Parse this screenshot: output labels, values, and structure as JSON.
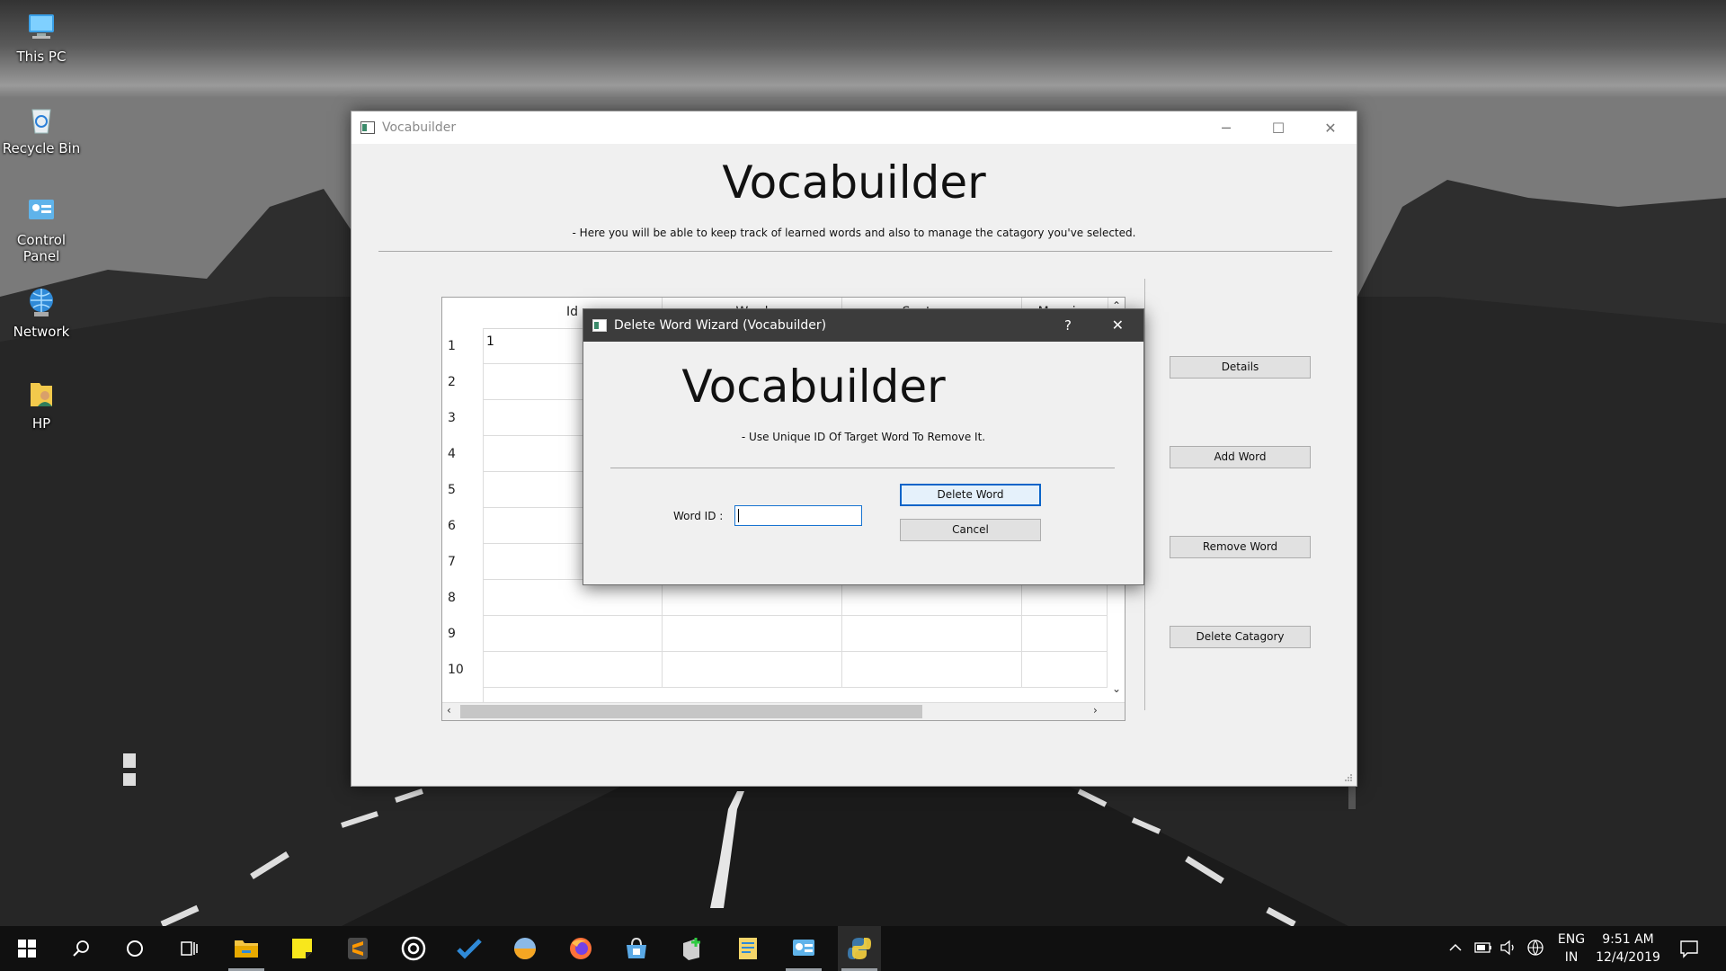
{
  "desktop": {
    "icons": [
      {
        "label": "This PC",
        "icon": "this-pc-icon"
      },
      {
        "label": "Recycle Bin",
        "icon": "recycle-bin-icon"
      },
      {
        "label": "Control Panel",
        "icon": "control-panel-icon"
      },
      {
        "label": "Network",
        "icon": "network-icon"
      },
      {
        "label": "HP",
        "icon": "user-folder-icon"
      }
    ]
  },
  "window": {
    "title": "Vocabuilder",
    "heading": "Vocabuilder",
    "subtitle": "- Here you will be able to keep track of learned words and also to manage the catagory you've selected.",
    "controls": {
      "minimize": "─",
      "maximize": "☐",
      "close": "✕"
    },
    "table": {
      "columns": [
        "Id",
        "Word",
        "Sentence",
        "Meaning"
      ],
      "row_numbers": [
        "1",
        "2",
        "3",
        "4",
        "5",
        "6",
        "7",
        "8",
        "9",
        "10"
      ],
      "rows": [
        [
          "1",
          "",
          "",
          ""
        ],
        [
          "",
          "",
          "",
          ""
        ],
        [
          "",
          "",
          "",
          ""
        ],
        [
          "",
          "",
          "",
          ""
        ],
        [
          "",
          "",
          "",
          ""
        ],
        [
          "",
          "",
          "",
          ""
        ],
        [
          "",
          "",
          "",
          ""
        ],
        [
          "",
          "",
          "",
          ""
        ],
        [
          "",
          "",
          "",
          ""
        ],
        [
          "",
          "",
          "",
          ""
        ]
      ]
    },
    "buttons": {
      "details": "Details",
      "add_word": "Add Word",
      "remove_word": "Remove Word",
      "delete_catagory": "Delete Catagory"
    }
  },
  "dialog": {
    "title": "Delete Word Wizard (Vocabuilder)",
    "help": "?",
    "close": "✕",
    "heading": "Vocabuilder",
    "subtitle": "- Use Unique ID Of Target Word To Remove It.",
    "word_id_label": "Word ID :",
    "word_id_value": "",
    "delete_button": "Delete Word",
    "cancel_button": "Cancel"
  },
  "taskbar": {
    "apps": [
      "file-explorer-icon",
      "sticky-notes-icon",
      "sublime-text-icon",
      "media-player-icon",
      "todo-icon",
      "weather-icon",
      "firefox-icon",
      "store-icon",
      "app-installer-icon",
      "notepad-icon",
      "control-panel-icon",
      "python-icon"
    ],
    "language": "ENG",
    "region": "IN",
    "time": "9:51 AM",
    "date": "12/4/2019"
  },
  "colors": {
    "accent": "#0a64c8",
    "taskbar": "#101010",
    "dialog_title": "#3c3c3c"
  }
}
